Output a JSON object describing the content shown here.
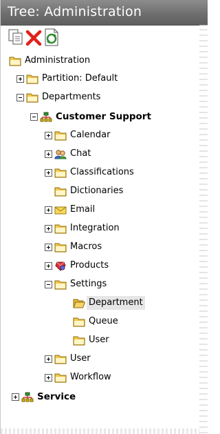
{
  "window": {
    "title": "Tree: Administration"
  },
  "toolbar": {
    "buttons": [
      "copy-icon",
      "delete-icon",
      "refresh-icon"
    ]
  },
  "tree": {
    "root": "Administration",
    "partition": "Partition: Default",
    "departments": "Departments",
    "customer_support": "Customer Support",
    "calendar": "Calendar",
    "chat": "Chat",
    "classifications": "Classifications",
    "dictionaries": "Dictionaries",
    "email": "Email",
    "integration": "Integration",
    "macros": "Macros",
    "products": "Products",
    "settings": "Settings",
    "department": "Department",
    "queue": "Queue",
    "user_setting": "User",
    "user": "User",
    "workflow": "Workflow",
    "service": "Service"
  },
  "colors": {
    "folder": "#f3c84a",
    "delete": "#e0201a",
    "refresh": "#2e8b2e",
    "title_bg": "#767676"
  }
}
